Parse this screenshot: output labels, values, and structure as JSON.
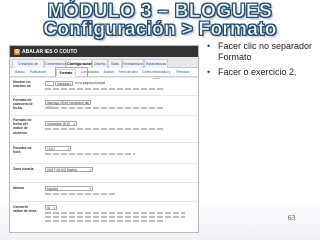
{
  "slide": {
    "title_line1": "MÓDULO 3 – BLOGUES",
    "title_line2": "Configuración > Formato",
    "bullets": [
      "Facer clic no separador Formato",
      "Facer o exercicio 2."
    ],
    "page_number": "63"
  },
  "blogger": {
    "logo_letter": "B",
    "blog_name": "ABALAR IES O COUTO",
    "main_tabs": [
      "Creación de entradas",
      "Comentarios",
      "Configuración",
      "Diseño",
      "Stats",
      "Rentabilizar",
      "Estadísticas"
    ],
    "sub_tabs": [
      "Básico",
      "Publicación",
      "Formato",
      "Comentarios",
      "Archivo",
      "Feed del sitio",
      "Correo electrónico y móvil",
      "Permisos"
    ],
    "rows": [
      {
        "label": "Mostrar un máximo de",
        "value": "7",
        "unit": "entradas",
        "extra": "en la página principal"
      },
      {
        "label": "Formato de cabecera de fecha",
        "value": "domingo 28 de noviembre de 2010"
      },
      {
        "label": "Formato de fecha del índice de archivos",
        "value": "noviembre 2010"
      },
      {
        "label": "Formato de hora",
        "value": "12:01"
      },
      {
        "label": "Zona horaria",
        "value": "(GMT+01:00) Madrid"
      },
      {
        "label": "Idioma",
        "value": "español"
      },
      {
        "label": "Convertir saltos de línea",
        "value": "Sí"
      }
    ]
  }
}
